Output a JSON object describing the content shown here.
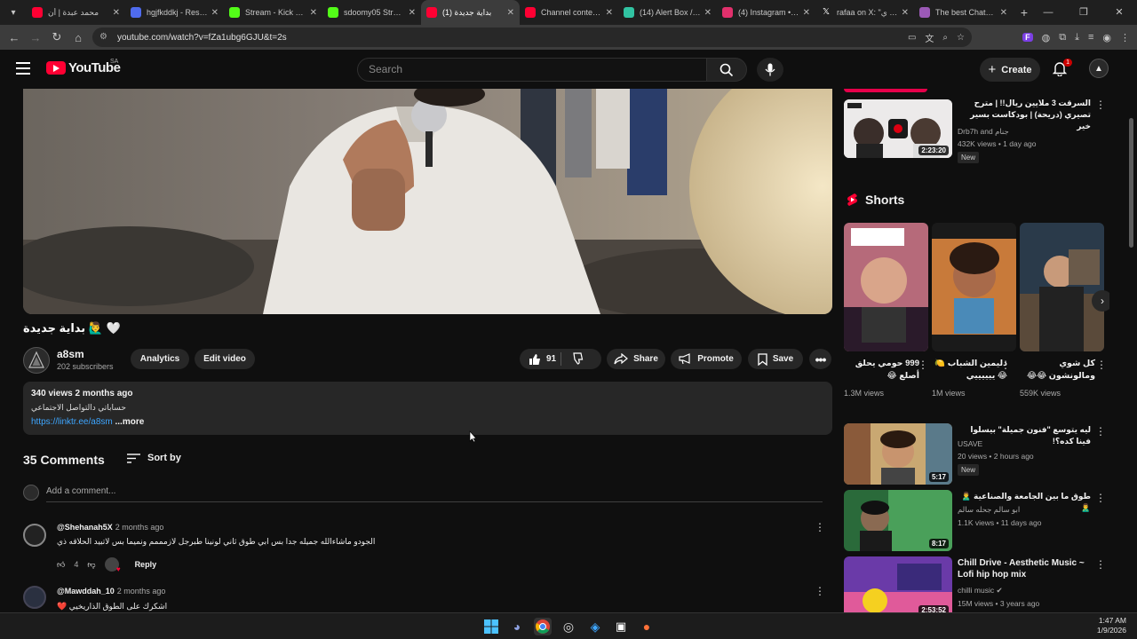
{
  "browser": {
    "tabs": [
      {
        "title": "محمد عبدة | أن",
        "color": "#ff0033"
      },
      {
        "title": "hgjfkddkj - Restre",
        "color": "#4f6bed"
      },
      {
        "title": "Stream - Kick Das",
        "color": "#53fc18"
      },
      {
        "title": "sdoomy05 Stream",
        "color": "#53fc18"
      },
      {
        "title": "(1) بداية جديدة",
        "color": "#ff0033",
        "active": true
      },
      {
        "title": "Channel content -",
        "color": "#ff0033"
      },
      {
        "title": "(14) Alert Box / St",
        "color": "#31c3a2"
      },
      {
        "title": "(4) Instagram • Me",
        "color": "#e1306c"
      },
      {
        "title": "rafaa on X: \"لكن ي",
        "color": "#ffffff"
      },
      {
        "title": "The best ChatBot",
        "color": "#9b59b6"
      }
    ],
    "new_tab": "+",
    "url": "youtube.com/watch?v=fZa1ubg6GJU&t=2s"
  },
  "header": {
    "logo": "YouTube",
    "country": "SA",
    "search_placeholder": "Search",
    "create_label": "Create",
    "notif_count": "1"
  },
  "video": {
    "title": "🤍 🙋‍♂️ بداية جديدة",
    "channel": "a8sm",
    "subscribers": "202 subscribers",
    "analytics_label": "Analytics",
    "edit_label": "Edit video",
    "likes": "91",
    "share_label": "Share",
    "promote_label": "Promote",
    "save_label": "Save",
    "views_date": "340 views  2 months ago",
    "desc_line": "حساباتي دالتواصل الاجتماعي",
    "desc_link": "https://linktr.ee/a8sm",
    "more_label": "...more"
  },
  "comments": {
    "count_label": "35 Comments",
    "sort_label": "Sort by",
    "add_placeholder": "Add a comment...",
    "items": [
      {
        "author": "@Shehanah5X",
        "time": "2 months ago",
        "text": "الجودو ماشاءالله جميله جدا  بس ابي طوق ثاني لونينا طبرجل لازمممم ونميما بس لاتبيد الحلاقه ذي",
        "likes": "4",
        "reply": "Reply"
      },
      {
        "author": "@Mawddah_10",
        "time": "2 months ago",
        "text": "❤️ اشكرك على الطوق الذاريخيي"
      }
    ]
  },
  "sidebar": {
    "top_video": {
      "title": "السرقت 3 ملايين ريال!! | مترح تصيري (دريحة) | بودكاست بسير خير",
      "channel": "Drb7h and جنام",
      "meta": "432K views • 1 day ago",
      "badge": "New",
      "duration": "2:23:20"
    },
    "shorts_label": "Shorts",
    "shorts": [
      {
        "title": "999 حومي يحلق أصلع 😂",
        "views": "1.3M views"
      },
      {
        "title": "دليمين الشباب 🍋😂 ييييييي",
        "views": "1M views"
      },
      {
        "title": "كل شوي ومالونشون 😂😂",
        "views": "559K views"
      }
    ],
    "videos": [
      {
        "title": "ليه يتوسع \"فنون جميلة\" بيسلوا فينا كده؟!",
        "channel": "USAVE",
        "meta": "20 views • 2 hours ago",
        "badge": "New",
        "duration": "5:17"
      },
      {
        "title": "طوق ما بين الجامعة والصناعية 🙎‍♂️ 🙎‍♂️",
        "channel": "ابو سالم جحله سالم",
        "meta": "1.1K views • 11 days ago",
        "duration": "8:17"
      },
      {
        "title": "Chill Drive - Aesthetic Music ~ Lofi hip hop mix",
        "channel": "chilli music",
        "meta": "15M views • 3 years ago",
        "duration": "2:53:52"
      }
    ]
  },
  "taskbar": {
    "time": "1:47 AM",
    "date": "1/9/2026"
  }
}
